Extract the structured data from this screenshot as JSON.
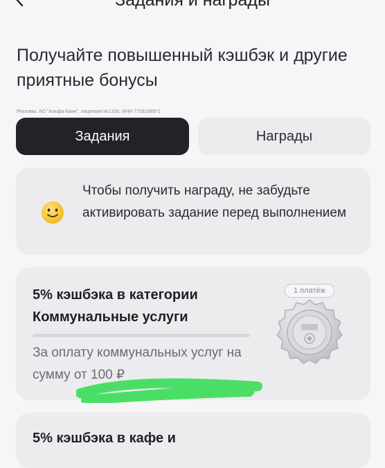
{
  "header": {
    "title": "Задания и награды"
  },
  "headline": "Получайте повышенный кэшбэк и другие приятные бонусы",
  "disclaimer": "Реклама. АО \"Альфа-Банк\", лицензия №1326, ИНН 7728168971",
  "tabs": [
    {
      "label": "Задания",
      "active": true
    },
    {
      "label": "Награды",
      "active": false
    }
  ],
  "info": {
    "icon": "smiley-emoji-icon",
    "text": "Чтобы получить награду, не забудьте активировать задание перед выполнением"
  },
  "tasks": [
    {
      "title": "5% кэшбэка в категории Коммунальные услуги",
      "description": "За оплату коммунальных услуг на сумму от 100 ₽",
      "badge": "1 платёж",
      "progress": 0,
      "icon": "medal-icon"
    },
    {
      "title": "5% кэшбэка в кафе и"
    }
  ],
  "colors": {
    "background": "#f6f6f8",
    "card": "#ececef",
    "active_tab": "#232327",
    "scribble": "#3ddc5a"
  }
}
